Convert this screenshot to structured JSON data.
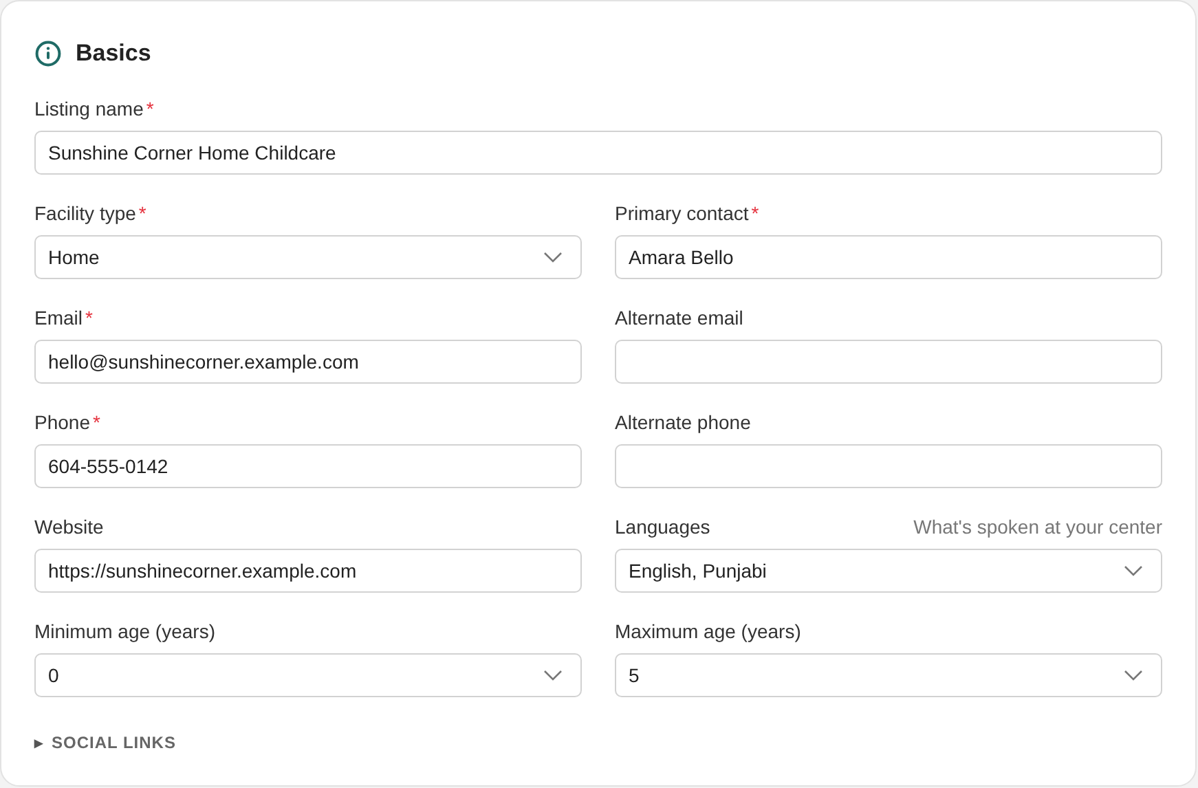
{
  "section": {
    "title": "Basics"
  },
  "name_field": {
    "label": "Listing name",
    "required_mark": "*",
    "kind": "text",
    "value": "Sunshine Corner Home Childcare"
  },
  "fields": [
    {
      "label": "Facility type",
      "required_mark": "*",
      "kind": "select",
      "value": "Home"
    },
    {
      "label": "Primary contact",
      "required_mark": "*",
      "kind": "text",
      "value": "Amara Bello"
    },
    {
      "label": "Email",
      "required_mark": "*",
      "kind": "text",
      "value": "hello@sunshinecorner.example.com"
    },
    {
      "label": "Alternate email",
      "kind": "text"
    },
    {
      "label": "Phone",
      "required_mark": "*",
      "kind": "text",
      "value": "604-555-0142"
    },
    {
      "label": "Alternate phone",
      "kind": "text"
    },
    {
      "label": "Website",
      "kind": "text",
      "value": "https://sunshinecorner.example.com"
    },
    {
      "label": "Languages",
      "kind": "select",
      "value": "English, Punjabi",
      "hint": "What's spoken at your center"
    },
    {
      "label": "Minimum age (years)",
      "kind": "select",
      "value": "0"
    },
    {
      "label": "Maximum age (years)",
      "kind": "select",
      "value": "5"
    }
  ],
  "disclosure": {
    "marker": "▶",
    "label": "SOCIAL LINKS",
    "expanded": false
  }
}
